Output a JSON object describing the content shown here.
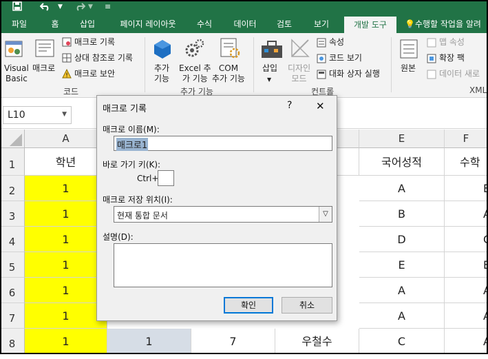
{
  "titlebar": {
    "save_icon": "save-icon",
    "undo_icon": "undo-icon",
    "redo_icon": "redo-icon",
    "customize_icon": "customize-quick-access-icon"
  },
  "tabs": [
    "파일",
    "홈",
    "삽입",
    "페이지 레이아웃",
    "수식",
    "데이터",
    "검토",
    "보기",
    "개발 도구"
  ],
  "tell_me": "수행할 작업을 알려",
  "ribbon": {
    "visual_basic": [
      "Visual",
      "Basic"
    ],
    "macro": "매크로",
    "record_macro": "매크로 기록",
    "relative_ref": "상대 참조로 기록",
    "macro_security": "매크로 보안",
    "group_code": "코드",
    "addins": [
      "추가",
      "기능"
    ],
    "excel_addins": [
      "Excel 추",
      "가 기능"
    ],
    "com_addins": [
      "COM",
      "추가 기능"
    ],
    "group_addins": "추가 기능",
    "insert": "삽입",
    "design_mode": [
      "디자인",
      "모드"
    ],
    "properties": "속성",
    "view_code": "코드 보기",
    "run_dialog": "대화 상자 실행",
    "group_controls": "컨트롤",
    "source": "원본",
    "map_properties": "맵 속성",
    "expansion_packs": "확장 팩",
    "refresh_data": "데이터 새로",
    "group_xml": "XML"
  },
  "namebox": {
    "value": "L10"
  },
  "columns": [
    "A",
    "",
    "",
    "",
    "E",
    "F"
  ],
  "rows": [
    {
      "num": "1",
      "cells": [
        "학년",
        "",
        "",
        "",
        "국어성적",
        "수학"
      ]
    },
    {
      "num": "2",
      "cells": [
        "1",
        "",
        "",
        "",
        "A",
        "E"
      ]
    },
    {
      "num": "3",
      "cells": [
        "1",
        "",
        "",
        "",
        "B",
        "A"
      ]
    },
    {
      "num": "4",
      "cells": [
        "1",
        "",
        "",
        "",
        "D",
        "C"
      ]
    },
    {
      "num": "5",
      "cells": [
        "1",
        "",
        "",
        "",
        "E",
        "E"
      ]
    },
    {
      "num": "6",
      "cells": [
        "1",
        "",
        "",
        "",
        "A",
        "A"
      ]
    },
    {
      "num": "7",
      "cells": [
        "1",
        "",
        "",
        "",
        "A",
        "A"
      ]
    },
    {
      "num": "8",
      "cells": [
        "1",
        "1",
        "7",
        "우철수",
        "C",
        "A"
      ]
    }
  ],
  "colors": {
    "excel_green": "#217346",
    "highlight_yellow": "#ffff00"
  },
  "dialog": {
    "title": "매크로 기록",
    "help": "?",
    "close": "✕",
    "name_label": "매크로 이름(M):",
    "name_value": "매크로1",
    "shortcut_label": "바로 가기 키(K):",
    "ctrl_label": "Ctrl+",
    "shortcut_value": "",
    "store_label": "매크로 저장 위치(I):",
    "store_value": "현재 통합 문서",
    "desc_label": "설명(D):",
    "desc_value": "",
    "ok": "확인",
    "cancel": "취소"
  }
}
